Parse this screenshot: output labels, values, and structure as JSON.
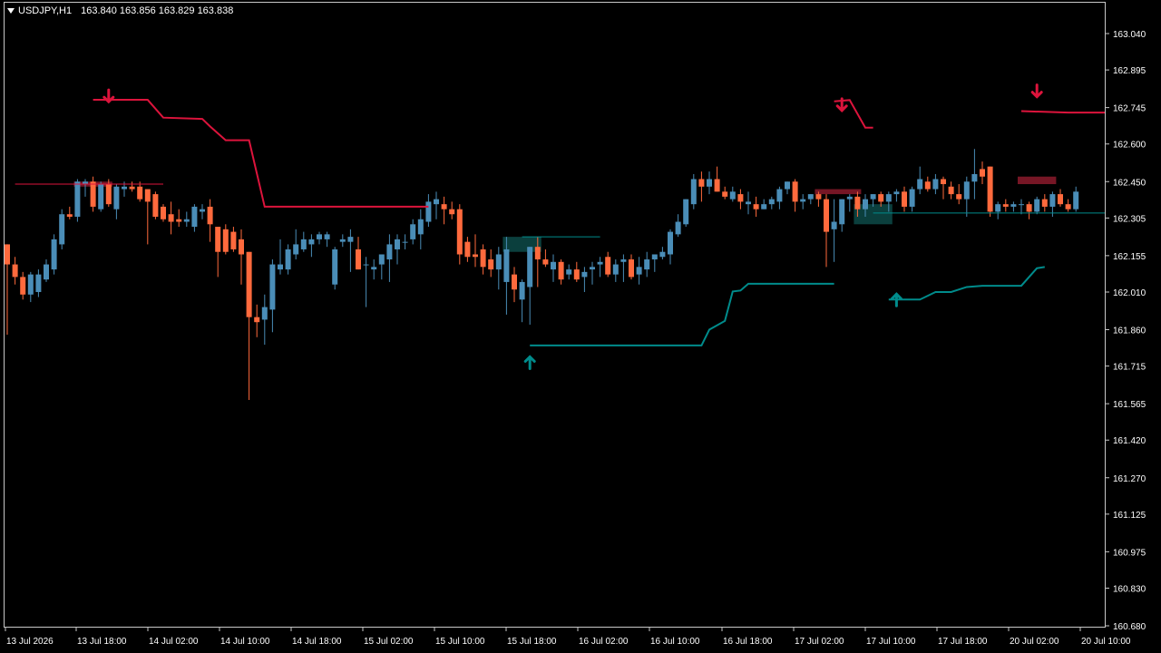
{
  "header": {
    "symbol_timeframe": "USDJPY,H1",
    "ohlc": "163.840 163.856 163.829 163.838"
  },
  "colors": {
    "background": "#000000",
    "frame": "#c8c8c8",
    "bull_candle": "#4a8db7",
    "bear_candle": "#ff6a3d",
    "resistance_line": "#dc143c",
    "support_line": "#008b8b",
    "axis_text": "#ffffff"
  },
  "chart_data": {
    "type": "candlestick",
    "symbol": "USDJPY",
    "timeframe": "H1",
    "ylim": [
      160.68,
      163.1
    ],
    "y_ticks": [
      "163.040",
      "162.895",
      "162.745",
      "162.600",
      "162.450",
      "162.305",
      "162.155",
      "162.010",
      "161.860",
      "161.715",
      "161.565",
      "161.420",
      "161.270",
      "161.125",
      "160.975",
      "160.830",
      "160.680"
    ],
    "x_ticks": [
      "13 Jul 2026",
      "13 Jul 18:00",
      "14 Jul 02:00",
      "14 Jul 10:00",
      "14 Jul 18:00",
      "15 Jul 02:00",
      "15 Jul 10:00",
      "15 Jul 18:00",
      "16 Jul 02:00",
      "16 Jul 10:00",
      "16 Jul 18:00",
      "17 Jul 02:00",
      "17 Jul 10:00",
      "17 Jul 18:00",
      "20 Jul 02:00",
      "20 Jul 10:00"
    ],
    "candles": [
      [
        162.2,
        162.2,
        161.84,
        162.12
      ],
      [
        162.12,
        162.15,
        162.04,
        162.07
      ],
      [
        162.07,
        162.09,
        161.98,
        162.0
      ],
      [
        162.0,
        162.09,
        161.97,
        162.08
      ],
      [
        162.01,
        162.1,
        161.99,
        162.08
      ],
      [
        162.06,
        162.14,
        162.05,
        162.12
      ],
      [
        162.1,
        162.24,
        162.08,
        162.22
      ],
      [
        162.2,
        162.34,
        162.18,
        162.32
      ],
      [
        162.32,
        162.35,
        162.3,
        162.31
      ],
      [
        162.31,
        162.46,
        162.29,
        162.45
      ],
      [
        162.44,
        162.46,
        162.39,
        162.45
      ],
      [
        162.45,
        162.47,
        162.33,
        162.35
      ],
      [
        162.34,
        162.45,
        162.33,
        162.44
      ],
      [
        162.44,
        162.46,
        162.35,
        162.36
      ],
      [
        162.34,
        162.44,
        162.3,
        162.43
      ],
      [
        162.42,
        162.45,
        162.39,
        162.43
      ],
      [
        162.43,
        162.45,
        162.41,
        162.42
      ],
      [
        162.43,
        162.45,
        162.37,
        162.38
      ],
      [
        162.42,
        162.41,
        162.2,
        162.37
      ],
      [
        162.4,
        162.41,
        162.3,
        162.31
      ],
      [
        162.35,
        162.36,
        162.29,
        162.3
      ],
      [
        162.32,
        162.37,
        162.24,
        162.29
      ],
      [
        162.3,
        162.34,
        162.27,
        162.29
      ],
      [
        162.29,
        162.33,
        162.27,
        162.3
      ],
      [
        162.27,
        162.36,
        162.25,
        162.35
      ],
      [
        162.33,
        162.36,
        162.3,
        162.34
      ],
      [
        162.35,
        162.38,
        162.21,
        162.28
      ],
      [
        162.27,
        162.27,
        162.07,
        162.17
      ],
      [
        162.26,
        162.28,
        162.16,
        162.17
      ],
      [
        162.25,
        162.27,
        162.17,
        162.18
      ],
      [
        162.22,
        162.26,
        162.04,
        162.16
      ],
      [
        162.17,
        162.17,
        161.58,
        161.91
      ],
      [
        161.91,
        161.96,
        161.83,
        161.89
      ],
      [
        161.9,
        162.0,
        161.8,
        161.95
      ],
      [
        161.94,
        162.14,
        161.85,
        162.12
      ],
      [
        162.1,
        162.22,
        162.08,
        162.12
      ],
      [
        162.1,
        162.2,
        162.08,
        162.18
      ],
      [
        162.16,
        162.26,
        162.14,
        162.2
      ],
      [
        162.18,
        162.25,
        162.17,
        162.22
      ],
      [
        162.2,
        162.24,
        162.15,
        162.22
      ],
      [
        162.22,
        162.25,
        162.2,
        162.24
      ],
      [
        162.22,
        162.25,
        162.19,
        162.24
      ],
      [
        162.04,
        162.19,
        162.02,
        162.18
      ],
      [
        162.21,
        162.24,
        162.19,
        162.22
      ],
      [
        162.21,
        162.26,
        162.09,
        162.23
      ],
      [
        162.18,
        162.23,
        162.1,
        162.1
      ],
      [
        162.12,
        162.15,
        161.95,
        162.12
      ],
      [
        162.1,
        162.14,
        162.06,
        162.11
      ],
      [
        162.12,
        162.15,
        162.06,
        162.16
      ],
      [
        162.14,
        162.24,
        162.05,
        162.2
      ],
      [
        162.18,
        162.24,
        162.12,
        162.22
      ],
      [
        162.21,
        162.24,
        162.18,
        162.21
      ],
      [
        162.22,
        162.3,
        162.2,
        162.28
      ],
      [
        162.24,
        162.34,
        162.18,
        162.3
      ],
      [
        162.29,
        162.4,
        162.27,
        162.37
      ],
      [
        162.36,
        162.41,
        162.3,
        162.38
      ],
      [
        162.36,
        162.39,
        162.28,
        162.34
      ],
      [
        162.34,
        162.37,
        162.3,
        162.32
      ],
      [
        162.34,
        162.36,
        162.12,
        162.16
      ],
      [
        162.21,
        162.23,
        162.13,
        162.15
      ],
      [
        162.16,
        162.24,
        162.11,
        162.15
      ],
      [
        162.18,
        162.2,
        162.08,
        162.11
      ],
      [
        162.14,
        162.18,
        162.07,
        162.1
      ],
      [
        162.1,
        162.19,
        162.02,
        162.16
      ],
      [
        162.05,
        162.23,
        161.92,
        162.18
      ],
      [
        162.08,
        162.11,
        161.97,
        162.02
      ],
      [
        161.98,
        162.06,
        161.89,
        162.05
      ],
      [
        162.03,
        162.19,
        161.88,
        162.19
      ],
      [
        162.19,
        162.23,
        162.03,
        162.14
      ],
      [
        162.14,
        162.18,
        162.11,
        162.12
      ],
      [
        162.1,
        162.16,
        162.05,
        162.13
      ],
      [
        162.13,
        162.14,
        162.04,
        162.06
      ],
      [
        162.08,
        162.12,
        162.06,
        162.1
      ],
      [
        162.1,
        162.13,
        162.05,
        162.06
      ],
      [
        162.07,
        162.11,
        162.01,
        162.09
      ],
      [
        162.1,
        162.13,
        162.04,
        162.11
      ],
      [
        162.12,
        162.15,
        162.07,
        162.13
      ],
      [
        162.15,
        162.17,
        162.07,
        162.08
      ],
      [
        162.08,
        162.14,
        162.05,
        162.12
      ],
      [
        162.13,
        162.16,
        162.05,
        162.14
      ],
      [
        162.14,
        162.16,
        162.06,
        162.07
      ],
      [
        162.08,
        162.15,
        162.04,
        162.11
      ],
      [
        162.1,
        162.17,
        162.07,
        162.14
      ],
      [
        162.14,
        162.16,
        162.09,
        162.16
      ],
      [
        162.15,
        162.19,
        162.14,
        162.17
      ],
      [
        162.16,
        162.26,
        162.12,
        162.25
      ],
      [
        162.24,
        162.32,
        162.23,
        162.29
      ],
      [
        162.28,
        162.38,
        162.27,
        162.38
      ],
      [
        162.36,
        162.48,
        162.34,
        162.46
      ],
      [
        162.46,
        162.49,
        162.37,
        162.43
      ],
      [
        162.43,
        162.49,
        162.4,
        162.46
      ],
      [
        162.46,
        162.51,
        162.41,
        162.41
      ],
      [
        162.41,
        162.43,
        162.38,
        162.39
      ],
      [
        162.38,
        162.43,
        162.37,
        162.41
      ],
      [
        162.4,
        162.42,
        162.34,
        162.37
      ],
      [
        162.36,
        162.41,
        162.32,
        162.37
      ],
      [
        162.36,
        162.39,
        162.31,
        162.34
      ],
      [
        162.34,
        162.38,
        162.34,
        162.36
      ],
      [
        162.36,
        162.39,
        162.34,
        162.38
      ],
      [
        162.37,
        162.43,
        162.34,
        162.42
      ],
      [
        162.42,
        162.45,
        162.4,
        162.45
      ],
      [
        162.45,
        162.46,
        162.33,
        162.37
      ],
      [
        162.37,
        162.4,
        162.34,
        162.38
      ],
      [
        162.38,
        162.4,
        162.36,
        162.4
      ],
      [
        162.4,
        162.41,
        162.35,
        162.38
      ],
      [
        162.38,
        162.4,
        162.11,
        162.25
      ],
      [
        162.26,
        162.38,
        162.13,
        162.29
      ],
      [
        162.28,
        162.38,
        162.25,
        162.38
      ],
      [
        162.38,
        162.4,
        162.33,
        162.39
      ],
      [
        162.39,
        162.41,
        162.31,
        162.34
      ],
      [
        162.34,
        162.4,
        162.31,
        162.38
      ],
      [
        162.38,
        162.4,
        162.35,
        162.4
      ],
      [
        162.4,
        162.41,
        162.35,
        162.37
      ],
      [
        162.37,
        162.41,
        162.33,
        162.4
      ],
      [
        162.4,
        162.42,
        162.37,
        162.41
      ],
      [
        162.41,
        162.43,
        162.33,
        162.35
      ],
      [
        162.35,
        162.43,
        162.33,
        162.42
      ],
      [
        162.42,
        162.51,
        162.4,
        162.46
      ],
      [
        162.45,
        162.47,
        162.41,
        162.42
      ],
      [
        162.42,
        162.48,
        162.4,
        162.46
      ],
      [
        162.46,
        162.47,
        162.38,
        162.44
      ],
      [
        162.43,
        162.45,
        162.38,
        162.4
      ],
      [
        162.4,
        162.44,
        162.36,
        162.38
      ],
      [
        162.38,
        162.47,
        162.31,
        162.45
      ],
      [
        162.45,
        162.58,
        162.38,
        162.48
      ],
      [
        162.5,
        162.53,
        162.44,
        162.47
      ],
      [
        162.51,
        162.51,
        162.31,
        162.33
      ],
      [
        162.33,
        162.37,
        162.3,
        162.36
      ],
      [
        162.36,
        162.38,
        162.33,
        162.35
      ],
      [
        162.35,
        162.37,
        162.33,
        162.36
      ],
      [
        162.36,
        162.38,
        162.32,
        162.36
      ],
      [
        162.36,
        162.37,
        162.3,
        162.33
      ],
      [
        162.33,
        162.39,
        162.32,
        162.38
      ],
      [
        162.38,
        162.4,
        162.33,
        162.35
      ],
      [
        162.35,
        162.41,
        162.31,
        162.4
      ],
      [
        162.4,
        162.42,
        162.35,
        162.36
      ],
      [
        162.36,
        162.38,
        162.33,
        162.34
      ],
      [
        162.34,
        162.43,
        162.33,
        162.41
      ]
    ],
    "resistance_segments": [
      [
        [
          1,
          162.44
        ],
        [
          20,
          162.44
        ]
      ],
      [
        [
          11,
          162.776
        ],
        [
          18,
          162.776
        ],
        [
          20,
          162.705
        ],
        [
          25,
          162.7
        ],
        [
          26,
          162.67
        ],
        [
          28,
          162.615
        ],
        [
          31,
          162.615
        ],
        [
          33,
          162.35
        ],
        [
          54,
          162.35
        ]
      ],
      [
        [
          106,
          162.77
        ],
        [
          108,
          162.775
        ],
        [
          110,
          162.665
        ],
        [
          111,
          162.665
        ]
      ],
      [
        [
          130,
          162.731
        ],
        [
          136,
          162.725
        ],
        [
          145,
          162.725
        ]
      ]
    ],
    "support_segments": [
      [
        [
          67,
          161.797
        ],
        [
          89,
          161.797
        ],
        [
          90,
          161.86
        ],
        [
          92,
          161.895
        ],
        [
          93,
          162.012
        ],
        [
          94,
          162.016
        ],
        [
          95,
          162.043
        ],
        [
          106,
          162.043
        ]
      ],
      [
        [
          113,
          161.98
        ],
        [
          117,
          161.98
        ],
        [
          119,
          162.01
        ],
        [
          121,
          162.01
        ],
        [
          123,
          162.03
        ],
        [
          125,
          162.035
        ],
        [
          128,
          162.035
        ],
        [
          130,
          162.035
        ],
        [
          132,
          162.105
        ],
        [
          133,
          162.11
        ]
      ],
      [
        [
          111,
          162.325
        ],
        [
          145,
          162.325
        ]
      ],
      [
        [
          66,
          162.23
        ],
        [
          76,
          162.23
        ]
      ]
    ],
    "sell_arrows": [
      [
        13,
        162.79
      ],
      [
        107,
        162.755
      ],
      [
        132,
        162.81
      ]
    ],
    "buy_arrows": [
      [
        67,
        161.73
      ],
      [
        114,
        161.98
      ]
    ],
    "zones": [
      {
        "type": "resistance",
        "from": 9,
        "to": 13,
        "top": 162.45,
        "bottom": 162.43
      },
      {
        "type": "resistance",
        "from": 104,
        "to": 109,
        "top": 162.42,
        "bottom": 162.4
      },
      {
        "type": "resistance",
        "from": 130,
        "to": 134,
        "top": 162.47,
        "bottom": 162.44
      },
      {
        "type": "support",
        "from": 64,
        "to": 68,
        "top": 162.23,
        "bottom": 162.17
      },
      {
        "type": "support",
        "from": 109,
        "to": 113,
        "top": 162.36,
        "bottom": 162.28
      }
    ]
  }
}
